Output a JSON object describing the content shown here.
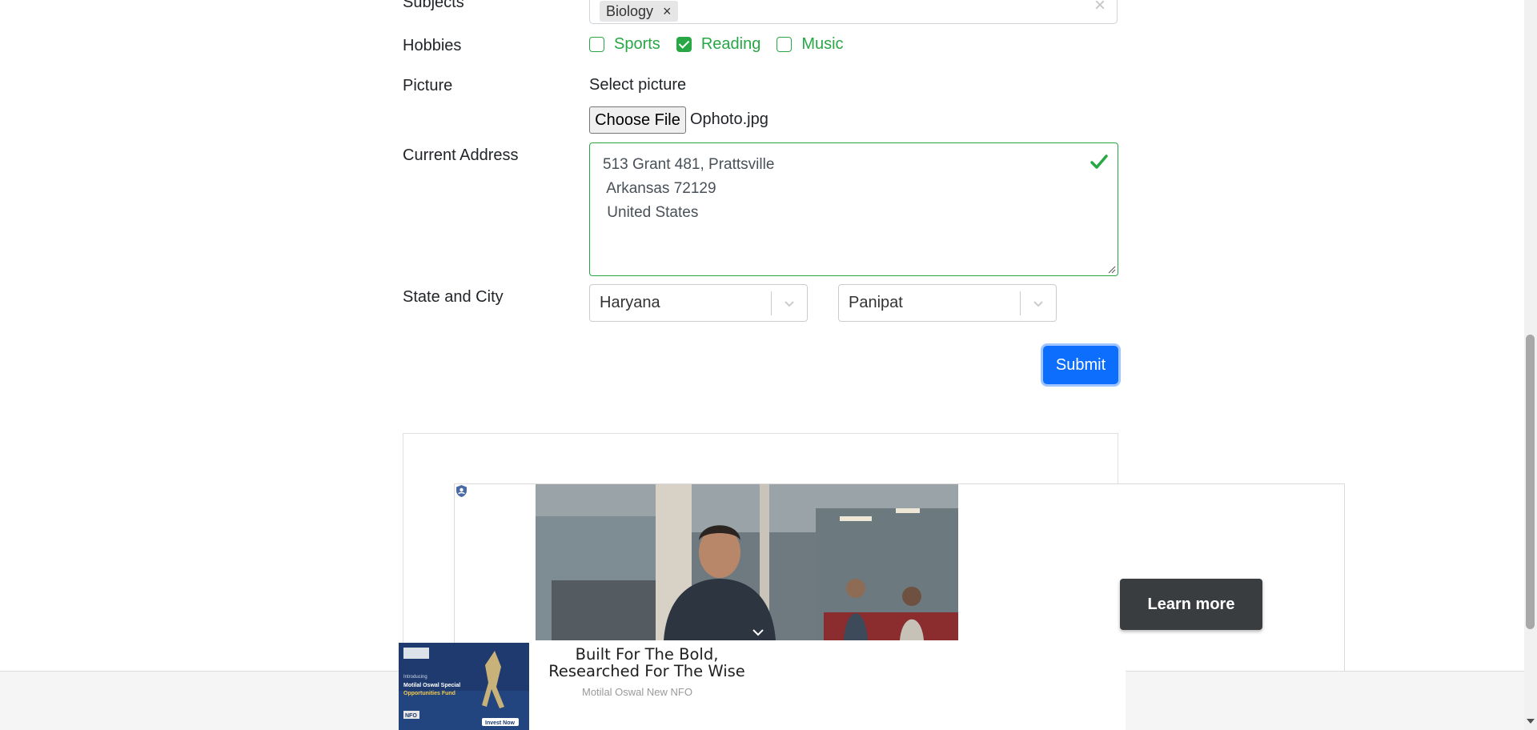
{
  "form": {
    "subjects_label": "Subjects",
    "subjects_chips": [
      "Biology"
    ],
    "chip_remove_glyph": "×",
    "clear_glyph": "×",
    "hobbies_label": "Hobbies",
    "hobbies": [
      {
        "label": "Sports",
        "checked": false
      },
      {
        "label": "Reading",
        "checked": true
      },
      {
        "label": "Music",
        "checked": false
      }
    ],
    "picture_label": "Picture",
    "select_picture_text": "Select picture",
    "choose_file_label": "Choose File",
    "file_name": "Ophoto.jpg",
    "address_label": "Current Address",
    "address_lines": [
      "513 Grant 481, Prattsville",
      " Arkansas 72129",
      " United States"
    ],
    "state_city_label": "State and City",
    "state_value": "Haryana",
    "city_value": "Panipat",
    "submit_label": "Submit"
  },
  "ad": {
    "learn_more_label": "Learn more",
    "banner_title_line1": "Built For The Bold,",
    "banner_title_line2": "Researched For The Wise",
    "banner_sponsor": "Motilal Oswal New NFO",
    "thumb_text_top": "Introducing",
    "thumb_text_title": "Motilal Oswal Special Opportunities Fund",
    "thumb_badge": "NFO",
    "thumb_cta": "Invest Now"
  },
  "colors": {
    "valid_green": "#28a745",
    "primary_blue": "#0d6efd",
    "learn_more_bg": "#3a3d40"
  },
  "icons": {
    "valid": "check-icon",
    "select_arrow": "chevron-down-icon",
    "ad_privacy": "shield-icon"
  }
}
